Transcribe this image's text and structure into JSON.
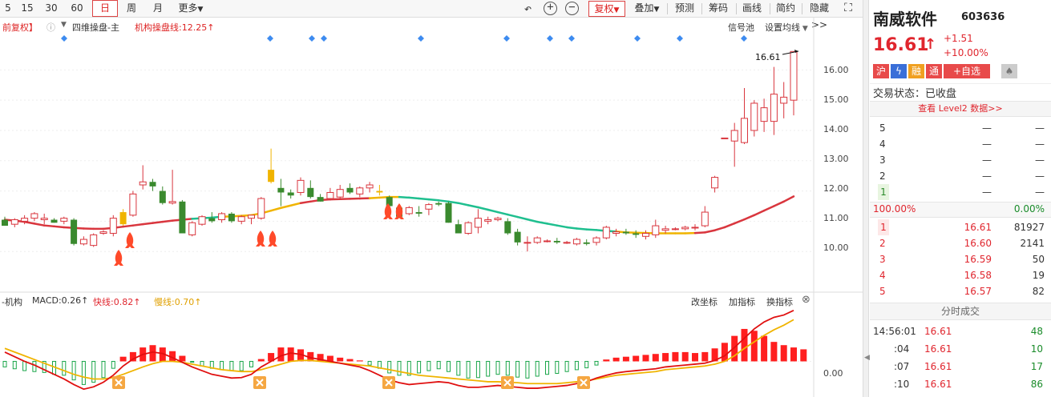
{
  "toolbar": {
    "periods": [
      "5",
      "15",
      "30",
      "60",
      "日",
      "周",
      "月",
      "更多"
    ],
    "active_period": "日",
    "fuquan_label": "复权",
    "overlay_label": "叠加",
    "forecast_label": "预测",
    "chips_label": "筹码",
    "draw_label": "画线",
    "simple_label": "简约",
    "hide_label": "隐藏>>"
  },
  "main_chart": {
    "fuquan_status": "前复权】",
    "indicator_name": "四维操盘-主",
    "inst_line_label": "机构操盘线:12.25↑",
    "signal_pool_label": "信号池",
    "set_ma_label": "设置均线",
    "last_price_label": "16.61",
    "y_ticks": [
      "16.00",
      "15.00",
      "14.00",
      "13.00",
      "12.00",
      "11.00",
      "10.00"
    ]
  },
  "sub_chart": {
    "prefix": "-机构",
    "macd_label": "MACD:0.26↑",
    "fast_label": "快线:0.82↑",
    "slow_label": "慢线:0.70↑",
    "change_axis_label": "改坐标",
    "add_indicator_label": "加指标",
    "switch_indicator_label": "换指标",
    "zero_label": "0.00"
  },
  "chart_data": {
    "type": "candlestick",
    "y_ticks": [
      16,
      15,
      14,
      13,
      12,
      11,
      10
    ],
    "ylim": [
      9.0,
      17.2
    ],
    "last_price": 16.61,
    "candles": [
      {
        "o": 11.05,
        "h": 11.15,
        "l": 10.85,
        "c": 10.85
      },
      {
        "o": 10.9,
        "h": 11.1,
        "l": 10.8,
        "c": 11.05
      },
      {
        "o": 11.0,
        "h": 11.2,
        "l": 10.9,
        "c": 11.1
      },
      {
        "o": 11.1,
        "h": 11.3,
        "l": 11.0,
        "c": 11.25
      },
      {
        "o": 11.05,
        "h": 11.25,
        "l": 10.9,
        "c": 11.1
      },
      {
        "o": 11.05,
        "h": 11.1,
        "l": 10.95,
        "c": 10.95
      },
      {
        "o": 11.0,
        "h": 11.15,
        "l": 10.9,
        "c": 11.1
      },
      {
        "o": 11.05,
        "h": 11.1,
        "l": 10.2,
        "c": 10.25
      },
      {
        "o": 10.25,
        "h": 10.5,
        "l": 10.2,
        "c": 10.4
      },
      {
        "o": 10.2,
        "h": 10.6,
        "l": 10.15,
        "c": 10.55
      },
      {
        "o": 10.6,
        "h": 10.7,
        "l": 10.55,
        "c": 10.65
      },
      {
        "o": 10.6,
        "h": 11.2,
        "l": 10.5,
        "c": 11.1
      },
      {
        "o": 10.9,
        "h": 11.4,
        "l": 10.85,
        "c": 11.3
      },
      {
        "o": 11.2,
        "h": 12.0,
        "l": 11.15,
        "c": 11.9
      },
      {
        "o": 12.2,
        "h": 12.85,
        "l": 12.05,
        "c": 12.3
      },
      {
        "o": 12.3,
        "h": 12.4,
        "l": 12.0,
        "c": 12.15
      },
      {
        "o": 12.0,
        "h": 12.15,
        "l": 11.55,
        "c": 11.6
      },
      {
        "o": 11.6,
        "h": 12.7,
        "l": 11.55,
        "c": 11.65
      },
      {
        "o": 11.65,
        "h": 11.7,
        "l": 10.6,
        "c": 10.6
      },
      {
        "o": 10.55,
        "h": 11.0,
        "l": 10.5,
        "c": 10.95
      },
      {
        "o": 10.9,
        "h": 11.2,
        "l": 10.85,
        "c": 11.15
      },
      {
        "o": 11.1,
        "h": 11.3,
        "l": 10.95,
        "c": 11.0
      },
      {
        "o": 11.05,
        "h": 11.3,
        "l": 10.95,
        "c": 11.25
      },
      {
        "o": 11.25,
        "h": 11.3,
        "l": 10.95,
        "c": 11.0
      },
      {
        "o": 11.0,
        "h": 11.2,
        "l": 10.9,
        "c": 11.15
      },
      {
        "o": 11.1,
        "h": 11.2,
        "l": 10.9,
        "c": 11.2
      },
      {
        "o": 11.1,
        "h": 11.8,
        "l": 11.05,
        "c": 11.75
      },
      {
        "o": 12.3,
        "h": 13.4,
        "l": 12.25,
        "c": 12.7
      },
      {
        "o": 12.1,
        "h": 12.4,
        "l": 11.5,
        "c": 11.95
      },
      {
        "o": 11.95,
        "h": 12.05,
        "l": 11.75,
        "c": 11.85
      },
      {
        "o": 11.95,
        "h": 12.45,
        "l": 11.85,
        "c": 12.35
      },
      {
        "o": 12.1,
        "h": 12.35,
        "l": 11.75,
        "c": 11.8
      },
      {
        "o": 11.8,
        "h": 11.9,
        "l": 11.65,
        "c": 11.65
      },
      {
        "o": 11.75,
        "h": 12.1,
        "l": 11.7,
        "c": 11.95
      },
      {
        "o": 11.8,
        "h": 12.2,
        "l": 11.75,
        "c": 12.05
      },
      {
        "o": 12.1,
        "h": 12.25,
        "l": 11.9,
        "c": 11.95
      },
      {
        "o": 11.9,
        "h": 12.15,
        "l": 11.8,
        "c": 12.1
      },
      {
        "o": 12.1,
        "h": 12.3,
        "l": 11.95,
        "c": 12.2
      },
      {
        "o": 12.0,
        "h": 12.2,
        "l": 11.85,
        "c": 11.95
      },
      {
        "o": 11.8,
        "h": 11.85,
        "l": 11.5,
        "c": 11.5
      },
      {
        "o": 11.45,
        "h": 11.5,
        "l": 11.1,
        "c": 11.15
      },
      {
        "o": 11.25,
        "h": 11.5,
        "l": 11.2,
        "c": 11.45
      },
      {
        "o": 11.3,
        "h": 11.5,
        "l": 11.15,
        "c": 11.25
      },
      {
        "o": 11.4,
        "h": 11.6,
        "l": 11.2,
        "c": 11.55
      },
      {
        "o": 11.6,
        "h": 11.65,
        "l": 11.5,
        "c": 11.55
      },
      {
        "o": 11.6,
        "h": 11.65,
        "l": 10.95,
        "c": 10.95
      },
      {
        "o": 10.9,
        "h": 11.05,
        "l": 10.6,
        "c": 10.6
      },
      {
        "o": 10.6,
        "h": 11.0,
        "l": 10.55,
        "c": 10.95
      },
      {
        "o": 10.8,
        "h": 11.4,
        "l": 10.6,
        "c": 11.1
      },
      {
        "o": 11.0,
        "h": 11.15,
        "l": 10.9,
        "c": 11.05
      },
      {
        "o": 11.05,
        "h": 11.15,
        "l": 11.0,
        "c": 11.1
      },
      {
        "o": 11.0,
        "h": 11.1,
        "l": 10.55,
        "c": 10.6
      },
      {
        "o": 10.65,
        "h": 10.75,
        "l": 10.2,
        "c": 10.3
      },
      {
        "o": 10.3,
        "h": 10.5,
        "l": 10.0,
        "c": 10.3
      },
      {
        "o": 10.3,
        "h": 10.5,
        "l": 10.25,
        "c": 10.45
      },
      {
        "o": 10.35,
        "h": 10.4,
        "l": 10.3,
        "c": 10.35
      },
      {
        "o": 10.35,
        "h": 10.45,
        "l": 10.25,
        "c": 10.3
      },
      {
        "o": 10.3,
        "h": 10.35,
        "l": 10.25,
        "c": 10.3
      },
      {
        "o": 10.25,
        "h": 10.45,
        "l": 10.2,
        "c": 10.4
      },
      {
        "o": 10.3,
        "h": 10.4,
        "l": 10.2,
        "c": 10.25
      },
      {
        "o": 10.3,
        "h": 10.5,
        "l": 10.2,
        "c": 10.45
      },
      {
        "o": 10.45,
        "h": 10.85,
        "l": 10.4,
        "c": 10.8
      },
      {
        "o": 10.6,
        "h": 10.75,
        "l": 10.5,
        "c": 10.65
      },
      {
        "o": 10.65,
        "h": 10.75,
        "l": 10.55,
        "c": 10.6
      },
      {
        "o": 10.6,
        "h": 10.7,
        "l": 10.45,
        "c": 10.55
      },
      {
        "o": 10.5,
        "h": 10.7,
        "l": 10.4,
        "c": 10.6
      },
      {
        "o": 10.55,
        "h": 11.05,
        "l": 10.45,
        "c": 10.85
      },
      {
        "o": 10.7,
        "h": 10.85,
        "l": 10.6,
        "c": 10.75
      },
      {
        "o": 10.75,
        "h": 10.8,
        "l": 10.7,
        "c": 10.75
      },
      {
        "o": 10.75,
        "h": 10.85,
        "l": 10.7,
        "c": 10.8
      },
      {
        "o": 10.8,
        "h": 10.9,
        "l": 10.7,
        "c": 10.8
      },
      {
        "o": 10.85,
        "h": 11.5,
        "l": 10.8,
        "c": 11.3
      },
      {
        "o": 12.1,
        "h": 12.5,
        "l": 11.95,
        "c": 12.45
      },
      {
        "o": 13.75,
        "h": 13.75,
        "l": 13.75,
        "c": 13.75
      },
      {
        "o": 13.65,
        "h": 14.25,
        "l": 12.8,
        "c": 14.0
      },
      {
        "o": 13.6,
        "h": 15.4,
        "l": 13.55,
        "c": 14.4
      },
      {
        "o": 14.0,
        "h": 15.0,
        "l": 13.8,
        "c": 14.9
      },
      {
        "o": 14.3,
        "h": 15.05,
        "l": 13.95,
        "c": 14.75
      },
      {
        "o": 14.3,
        "h": 16.1,
        "l": 13.85,
        "c": 15.2
      },
      {
        "o": 14.9,
        "h": 15.6,
        "l": 14.4,
        "c": 15.1
      },
      {
        "o": 15.0,
        "h": 16.61,
        "l": 14.5,
        "c": 16.61
      }
    ],
    "main_line": [
      11.05,
      11.02,
      10.98,
      10.92,
      10.86,
      10.83,
      10.8,
      10.78,
      10.76,
      10.75,
      10.75,
      10.78,
      10.82,
      10.86,
      10.9,
      10.94,
      10.98,
      11.02,
      11.05,
      11.08,
      11.1,
      11.12,
      11.15,
      11.16,
      11.18,
      11.2,
      11.26,
      11.35,
      11.44,
      11.52,
      11.6,
      11.65,
      11.7,
      11.72,
      11.73,
      11.74,
      11.75,
      11.76,
      11.78,
      11.8,
      11.8,
      11.78,
      11.75,
      11.72,
      11.69,
      11.65,
      11.6,
      11.53,
      11.46,
      11.38,
      11.3,
      11.22,
      11.14,
      11.06,
      10.98,
      10.92,
      10.86,
      10.8,
      10.76,
      10.73,
      10.71,
      10.68,
      10.66,
      10.63,
      10.62,
      10.61,
      10.6,
      10.6,
      10.6,
      10.6,
      10.61,
      10.63,
      10.7,
      10.8,
      10.93,
      11.06,
      11.2,
      11.35,
      11.5,
      11.65,
      11.82
    ],
    "sub_ylim": [
      -0.7,
      1.2
    ],
    "macd_hist": [
      -0.12,
      -0.16,
      -0.2,
      -0.22,
      -0.24,
      -0.28,
      -0.3,
      -0.4,
      -0.5,
      -0.45,
      -0.35,
      -0.15,
      0.1,
      0.2,
      0.3,
      0.35,
      0.3,
      0.22,
      0.12,
      -0.02,
      -0.1,
      -0.15,
      -0.18,
      -0.2,
      -0.2,
      -0.12,
      0.05,
      0.18,
      0.3,
      0.3,
      0.26,
      0.2,
      0.16,
      0.12,
      0.08,
      0.05,
      0.02,
      -0.08,
      -0.15,
      -0.25,
      -0.3,
      -0.3,
      -0.25,
      -0.2,
      -0.16,
      -0.22,
      -0.3,
      -0.36,
      -0.35,
      -0.32,
      -0.28,
      -0.3,
      -0.34,
      -0.36,
      -0.32,
      -0.28,
      -0.26,
      -0.22,
      -0.18,
      -0.14,
      -0.08,
      0.04,
      0.08,
      0.1,
      0.12,
      0.14,
      0.16,
      0.18,
      0.2,
      0.2,
      0.18,
      0.2,
      0.28,
      0.4,
      0.55,
      0.7,
      0.66,
      0.55,
      0.42,
      0.35,
      0.3,
      0.26
    ],
    "fast_line": [
      0.2,
      0.1,
      0.0,
      -0.08,
      -0.18,
      -0.28,
      -0.38,
      -0.5,
      -0.6,
      -0.55,
      -0.45,
      -0.3,
      -0.1,
      0.05,
      0.15,
      0.2,
      0.17,
      0.08,
      -0.02,
      -0.12,
      -0.2,
      -0.28,
      -0.32,
      -0.36,
      -0.35,
      -0.28,
      -0.12,
      0.0,
      0.12,
      0.18,
      0.15,
      0.08,
      0.04,
      0.0,
      -0.04,
      -0.08,
      -0.12,
      -0.2,
      -0.3,
      -0.4,
      -0.46,
      -0.5,
      -0.48,
      -0.46,
      -0.44,
      -0.46,
      -0.52,
      -0.56,
      -0.56,
      -0.54,
      -0.52,
      -0.54,
      -0.56,
      -0.58,
      -0.58,
      -0.56,
      -0.54,
      -0.52,
      -0.48,
      -0.44,
      -0.36,
      -0.3,
      -0.25,
      -0.22,
      -0.2,
      -0.18,
      -0.16,
      -0.12,
      -0.1,
      -0.08,
      -0.06,
      -0.04,
      0.02,
      0.12,
      0.3,
      0.5,
      0.7,
      0.85,
      0.95,
      1.0,
      1.1
    ],
    "slow_line": [
      0.28,
      0.2,
      0.12,
      0.04,
      -0.04,
      -0.12,
      -0.2,
      -0.28,
      -0.34,
      -0.38,
      -0.38,
      -0.35,
      -0.28,
      -0.2,
      -0.12,
      -0.05,
      0.0,
      0.0,
      -0.02,
      -0.06,
      -0.1,
      -0.14,
      -0.18,
      -0.2,
      -0.22,
      -0.22,
      -0.18,
      -0.12,
      -0.06,
      0.0,
      0.02,
      0.02,
      0.0,
      -0.02,
      -0.04,
      -0.06,
      -0.08,
      -0.1,
      -0.14,
      -0.18,
      -0.22,
      -0.26,
      -0.3,
      -0.32,
      -0.34,
      -0.36,
      -0.38,
      -0.4,
      -0.42,
      -0.44,
      -0.44,
      -0.45,
      -0.46,
      -0.48,
      -0.48,
      -0.48,
      -0.48,
      -0.46,
      -0.44,
      -0.42,
      -0.38,
      -0.34,
      -0.3,
      -0.28,
      -0.26,
      -0.24,
      -0.22,
      -0.18,
      -0.16,
      -0.14,
      -0.12,
      -0.1,
      -0.06,
      0.0,
      0.12,
      0.28,
      0.42,
      0.56,
      0.68,
      0.78,
      0.9
    ]
  },
  "right_panel": {
    "stock_name": "南威软件",
    "stock_code": "603636",
    "price": "16.61",
    "change": "+1.51",
    "change_pct": "+10.00%",
    "badges": [
      "沪",
      "融",
      "通",
      "+自选"
    ],
    "trade_status": "交易状态：已收盘",
    "level2_label": "查看 Level2 数据>>",
    "ask_levels": [
      {
        "level": "5",
        "price": "—",
        "vol": "—"
      },
      {
        "level": "4",
        "price": "—",
        "vol": "—"
      },
      {
        "level": "3",
        "price": "—",
        "vol": "—"
      },
      {
        "level": "2",
        "price": "—",
        "vol": "—"
      },
      {
        "level": "1",
        "price": "—",
        "vol": "—"
      }
    ],
    "buy_ratio": "100.00%",
    "sell_ratio": "0.00%",
    "bid_levels": [
      {
        "level": "1",
        "price": "16.61",
        "vol": "81927"
      },
      {
        "level": "2",
        "price": "16.60",
        "vol": "2141"
      },
      {
        "level": "3",
        "price": "16.59",
        "vol": "50"
      },
      {
        "level": "4",
        "price": "16.58",
        "vol": "19"
      },
      {
        "level": "5",
        "price": "16.57",
        "vol": "82"
      }
    ],
    "ticks_title": "分时成交",
    "ticks": [
      {
        "time": "14:56:01",
        "price": "16.61",
        "vol": "48"
      },
      {
        "time": ":04",
        "price": "16.61",
        "vol": "10"
      },
      {
        "time": ":07",
        "price": "16.61",
        "vol": "17"
      },
      {
        "time": ":10",
        "price": "16.61",
        "vol": "86"
      }
    ]
  },
  "colors": {
    "up": "#d9363e",
    "down": "#3a8a2e",
    "yellow": "#f0b400",
    "teal": "#1fbf8f",
    "macd_up": "#ff1f1f",
    "macd_down": "#1aa64a",
    "accent": "#e0262e"
  }
}
